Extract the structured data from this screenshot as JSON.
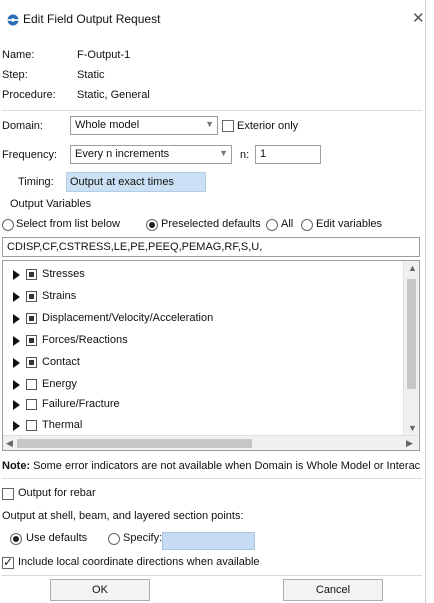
{
  "window": {
    "title": "Edit Field Output Request",
    "close_glyph": "✕"
  },
  "info": {
    "name_label": "Name:",
    "name_value": "F-Output-1",
    "step_label": "Step:",
    "step_value": "Static",
    "procedure_label": "Procedure:",
    "procedure_value": "Static, General"
  },
  "domain": {
    "label": "Domain:",
    "value": "Whole model",
    "exterior_label": "Exterior only",
    "exterior_checked": false
  },
  "frequency": {
    "label": "Frequency:",
    "value": "Every n increments",
    "n_label": "n:",
    "n_value": "1"
  },
  "timing": {
    "label": "Timing:",
    "value": "Output at exact times"
  },
  "output_vars": {
    "section_label": "Output Variables",
    "radio_select": "Select from list below",
    "radio_preselected": "Preselected defaults",
    "radio_all": "All",
    "radio_edit": "Edit variables",
    "selected": "preselected",
    "vars_text": "CDISP,CF,CSTRESS,LE,PE,PEEQ,PEMAG,RF,S,U,"
  },
  "tree": {
    "items": [
      {
        "label": "Stresses",
        "state": "partial"
      },
      {
        "label": "Strains",
        "state": "partial"
      },
      {
        "label": "Displacement/Velocity/Acceleration",
        "state": "partial"
      },
      {
        "label": "Forces/Reactions",
        "state": "partial"
      },
      {
        "label": "Contact",
        "state": "partial"
      },
      {
        "label": "Energy",
        "state": "unchecked"
      },
      {
        "label": "Failure/Fracture",
        "state": "unchecked"
      },
      {
        "label": "Thermal",
        "state": "unchecked"
      }
    ]
  },
  "note": {
    "prefix": "Note:",
    "text": "Some error indicators are not available when Domain is Whole Model or Interac"
  },
  "rebar": {
    "label": "Output for rebar",
    "checked": false
  },
  "shell": {
    "label": "Output at shell, beam, and layered section points:",
    "use_defaults_label": "Use defaults",
    "specify_label": "Specify:",
    "selected": "defaults"
  },
  "local_coords": {
    "label": "Include local coordinate directions when available",
    "checked": true
  },
  "buttons": {
    "ok": "OK",
    "cancel": "Cancel"
  },
  "colors": {
    "timing_bg": "#cbe0f4",
    "specify_bg": "#c5dcf2",
    "icon_blue": "#2b6cb3"
  },
  "icons": {
    "title": "gear-icon",
    "expand": "triangle-right-icon",
    "dropdown": "chevron-down-icon"
  }
}
